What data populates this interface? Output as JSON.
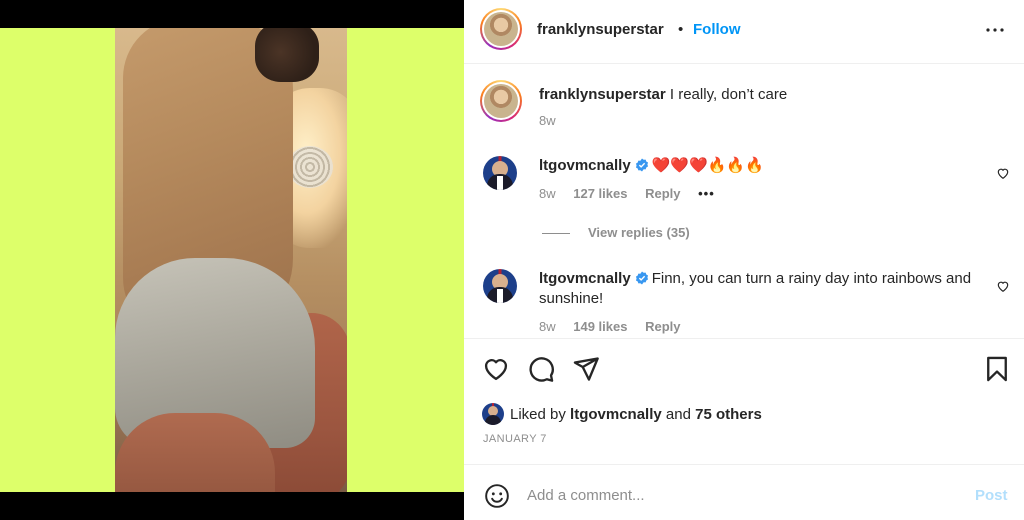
{
  "header": {
    "username": "franklynsuperstar",
    "separator": "•",
    "follow_label": "Follow"
  },
  "caption": {
    "username": "franklynsuperstar",
    "text": " I really, don’t care",
    "time": "8w"
  },
  "comments": [
    {
      "username": "ltgovmcnally",
      "verified": true,
      "text": "❤️❤️❤️🔥🔥🔥",
      "time": "8w",
      "likes": "127 likes",
      "reply_label": "Reply",
      "more": "•••"
    },
    {
      "username": "ltgovmcnally",
      "verified": true,
      "text": "Finn, you can turn a rainy day into rainbows and sunshine!",
      "time": "8w",
      "likes": "149 likes",
      "reply_label": "Reply"
    }
  ],
  "view_replies": "View replies (35)",
  "likes_summary": {
    "prefix": "Liked by ",
    "user": "ltgovmcnally",
    "middle": " and ",
    "others": "75 others"
  },
  "date": "JANUARY 7",
  "add_comment": {
    "placeholder": "Add a comment...",
    "post_label": "Post"
  },
  "icons": {
    "more": "more-horizontal-icon",
    "like": "heart-icon",
    "comment": "comment-bubble-icon",
    "share": "paper-plane-icon",
    "save": "bookmark-icon",
    "emoji": "smiley-icon",
    "verified": "verified-badge-icon"
  },
  "colors": {
    "photo_background": "#ddff6a",
    "follow": "#0095f6",
    "post_disabled": "#b2dffc",
    "muted": "#8e8e8e",
    "verified": "#3897f0"
  }
}
